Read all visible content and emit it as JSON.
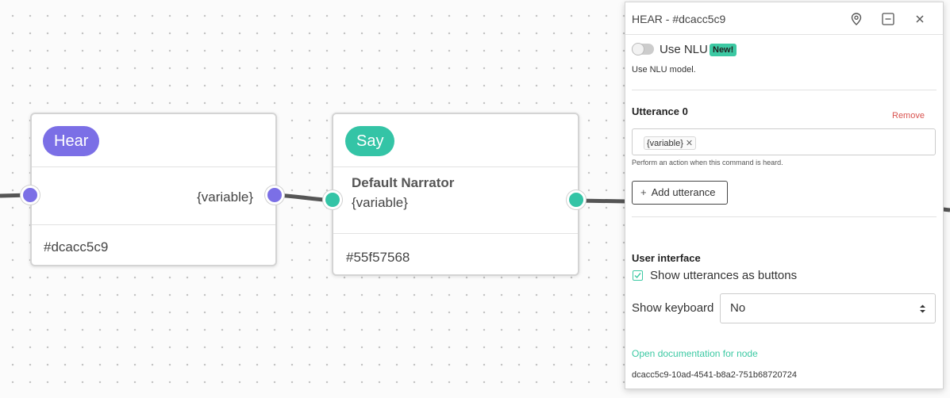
{
  "canvas": {
    "hear_node": {
      "pill": "Hear",
      "variable": "{variable}",
      "id": "#dcacc5c9",
      "color": "#7b6fe6"
    },
    "say_node": {
      "pill": "Say",
      "narrator": "Default Narrator",
      "variable": "{variable}",
      "id": "#55f57568",
      "color": "#34c4a6"
    }
  },
  "panel": {
    "title": "HEAR - #dcacc5c9",
    "icons": [
      "location-pin-icon",
      "minimize-icon",
      "close-icon"
    ],
    "nlu": {
      "label": "Use NLU",
      "badge": "New!",
      "description": "Use NLU model.",
      "enabled": false
    },
    "utterance": {
      "heading": "Utterance 0",
      "remove_label": "Remove",
      "chip": "{variable}",
      "hint": "Perform an action when this command is heard."
    },
    "add_utterance_label": "Add utterance",
    "user_interface": {
      "heading": "User interface",
      "checkbox_label": "Show utterances as buttons",
      "checked": true,
      "keyboard_label": "Show keyboard",
      "keyboard_value": "No"
    },
    "doc_link": "Open documentation for node",
    "node_uuid": "dcacc5c9-10ad-4541-b8a2-751b68720724"
  },
  "colors": {
    "accent": "#3cc9a3",
    "danger": "#d9534f",
    "hear": "#7b6fe6",
    "say": "#34c4a6"
  }
}
